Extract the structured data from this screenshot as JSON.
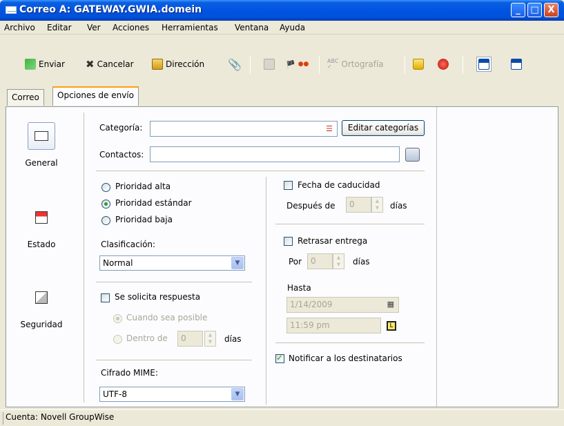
{
  "window": {
    "title": "Correo A: GATEWAY.GWIA.domein",
    "controls": [
      "_",
      "□",
      "X"
    ]
  },
  "menu": [
    "Archivo",
    "Editar",
    "Ver",
    "Acciones",
    "Herramientas",
    "Ventana",
    "Ayuda"
  ],
  "toolbar": {
    "send_label": "Enviar",
    "cancel_label": "Cancelar",
    "address_label": "Dirección",
    "spelling_label": "Ortografía"
  },
  "tabs": [
    "Correo",
    "Opciones de envío"
  ],
  "sidebar": {
    "general": "General",
    "status": "Estado",
    "security": "Seguridad"
  },
  "form": {
    "category_label": "Categoría:",
    "category_value": "",
    "edit_categories_label": "Editar categorías",
    "contacts_label": "Contactos:",
    "contacts_value": "",
    "priority": [
      "Prioridad alta",
      "Prioridad estándar",
      "Prioridad baja"
    ],
    "priority_selected": "Prioridad estándar",
    "classification_label": "Clasificación:",
    "classification_value": "Normal",
    "reply_requested_label": "Se solicita respuesta",
    "reply_requested": false,
    "when_possible_label": "Cuando sea posible",
    "within_label": "Dentro de",
    "within_value": "0",
    "days_label": "días",
    "mime_label": "Cifrado MIME:",
    "mime_value": "UTF-8",
    "expiration_label": "Fecha de caducidad",
    "expiration_checked": false,
    "after_label": "Después de",
    "after_value": "0",
    "delay_label": "Retrasar entrega",
    "delay_checked": false,
    "by_label": "Por",
    "by_value": "0",
    "until_label": "Hasta",
    "until_date": "1/14/2009",
    "until_time": "11:59 pm",
    "notify_label": "Notificar a los destinatarios",
    "notify_checked": true
  },
  "status": {
    "account": "Cuenta: Novell GroupWise"
  }
}
